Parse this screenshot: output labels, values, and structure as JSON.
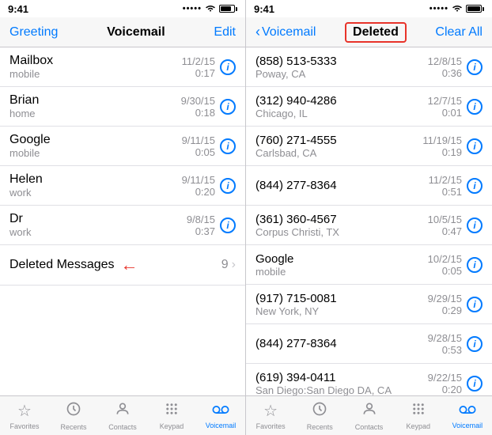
{
  "left": {
    "statusBar": {
      "time": "9:41",
      "signal": "•••••",
      "wifi": "wifi",
      "battery": "battery"
    },
    "nav": {
      "left": "Greeting",
      "title": "Voicemail",
      "right": "Edit"
    },
    "items": [
      {
        "name": "Mailbox",
        "sub": "mobile",
        "date": "11/2/15",
        "duration": "0:17"
      },
      {
        "name": "Brian",
        "sub": "home",
        "date": "9/30/15",
        "duration": "0:18"
      },
      {
        "name": "Google",
        "sub": "mobile",
        "date": "9/11/15",
        "duration": "0:05"
      },
      {
        "name": "Helen",
        "sub": "work",
        "date": "9/11/15",
        "duration": "0:20"
      },
      {
        "name": "Dr",
        "sub": "work",
        "date": "9/8/15",
        "duration": "0:37"
      }
    ],
    "deletedMessages": {
      "label": "Deleted Messages",
      "count": "9"
    },
    "tabs": [
      {
        "icon": "☆",
        "label": "Favorites"
      },
      {
        "icon": "🕐",
        "label": "Recents"
      },
      {
        "icon": "👤",
        "label": "Contacts"
      },
      {
        "icon": "⌨",
        "label": "Keypad"
      },
      {
        "icon": "📞",
        "label": "Voicemail",
        "active": true
      }
    ]
  },
  "right": {
    "statusBar": {
      "time": "9:41",
      "signal": "•••••",
      "wifi": "wifi",
      "battery": "battery"
    },
    "nav": {
      "back": "Voicemail",
      "title": "Deleted",
      "right": "Clear All"
    },
    "items": [
      {
        "number": "(858) 513-5333",
        "sub": "Poway, CA",
        "date": "12/8/15",
        "duration": "0:36"
      },
      {
        "number": "(312) 940-4286",
        "sub": "Chicago, IL",
        "date": "12/7/15",
        "duration": "0:01"
      },
      {
        "number": "(760) 271-4555",
        "sub": "Carlsbad, CA",
        "date": "11/19/15",
        "duration": "0:19"
      },
      {
        "number": "(844) 277-8364",
        "sub": "",
        "date": "11/2/15",
        "duration": "0:51"
      },
      {
        "number": "(361) 360-4567",
        "sub": "Corpus Christi, TX",
        "date": "10/5/15",
        "duration": "0:47"
      },
      {
        "number": "Google",
        "sub": "mobile",
        "date": "10/2/15",
        "duration": "0:05"
      },
      {
        "number": "(917) 715-0081",
        "sub": "New York, NY",
        "date": "9/29/15",
        "duration": "0:29"
      },
      {
        "number": "(844) 277-8364",
        "sub": "",
        "date": "9/28/15",
        "duration": "0:53"
      },
      {
        "number": "(619) 394-0411",
        "sub": "San Diego:San Diego DA, CA",
        "date": "9/22/15",
        "duration": "0:20"
      }
    ],
    "tabs": [
      {
        "icon": "☆",
        "label": "Favorites"
      },
      {
        "icon": "🕐",
        "label": "Recents"
      },
      {
        "icon": "👤",
        "label": "Contacts"
      },
      {
        "icon": "⌨",
        "label": "Keypad"
      },
      {
        "icon": "📞",
        "label": "Voicemail",
        "active": true
      }
    ]
  }
}
